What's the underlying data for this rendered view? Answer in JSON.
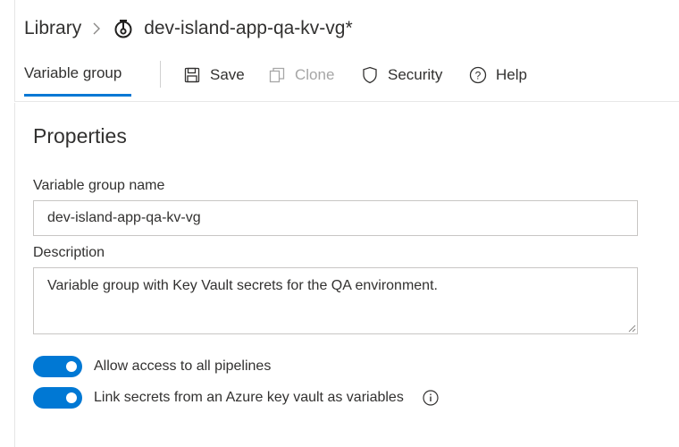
{
  "breadcrumb": {
    "library_label": "Library",
    "separator_icon": "chevron-right-icon",
    "item_icon": "variable-group-icon",
    "item_title": "dev-island-app-qa-kv-vg*"
  },
  "toolbar": {
    "active_tab": "Variable group",
    "save_label": "Save",
    "clone_label": "Clone",
    "security_label": "Security",
    "help_label": "Help",
    "clone_disabled": true
  },
  "properties": {
    "title": "Properties",
    "name_label": "Variable group name",
    "name_value": "dev-island-app-qa-kv-vg",
    "description_label": "Description",
    "description_value": "Variable group with Key Vault secrets for the QA environment.",
    "toggles": [
      {
        "label": "Allow access to all pipelines",
        "on": true
      },
      {
        "label": "Link secrets from an Azure key vault as variables",
        "on": true,
        "has_info": true
      }
    ]
  },
  "colors": {
    "accent": "#0078d4",
    "text": "#323130",
    "disabled": "#a6a6a6",
    "border": "#c8c6c4"
  }
}
